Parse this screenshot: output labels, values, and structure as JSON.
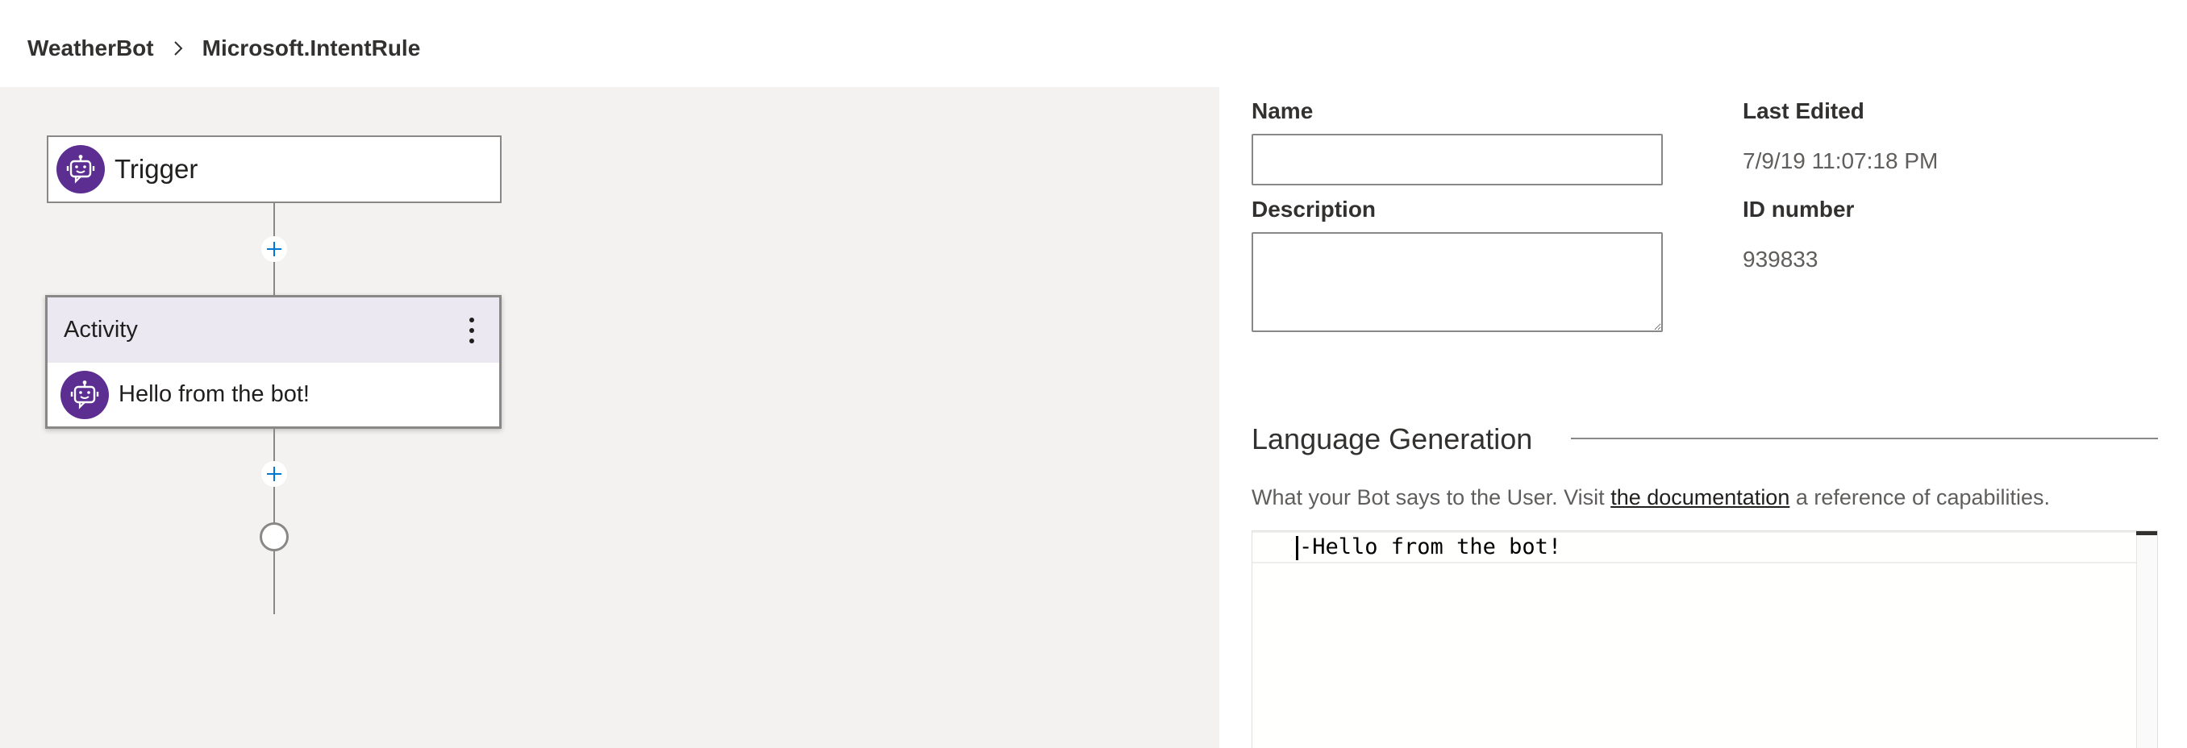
{
  "breadcrumb": {
    "items": [
      "WeatherBot"
    ],
    "current": "Microsoft.IntentRule",
    "separator_icon": "chevron-right-icon"
  },
  "canvas": {
    "trigger": {
      "label": "Trigger",
      "icon": "bot-icon"
    },
    "activity": {
      "title": "Activity",
      "menu_icon": "more-vertical-icon",
      "message": "Hello from the bot!",
      "icon": "bot-icon"
    },
    "add_step_icon": "plus-icon",
    "end_icon": "end-circle-icon"
  },
  "properties": {
    "name": {
      "label": "Name",
      "value": "",
      "placeholder": ""
    },
    "description": {
      "label": "Description",
      "value": "",
      "placeholder": ""
    },
    "last_edited": {
      "label": "Last Edited",
      "value": "7/9/19 11:07:18 PM"
    },
    "id_number": {
      "label": "ID number",
      "value": "939833"
    }
  },
  "language_generation": {
    "title": "Language Generation",
    "help_prefix": "What your Bot says to the User. Visit ",
    "help_link": "the documentation",
    "help_suffix": " a reference of capabilities.",
    "editor_text": "-Hello from the bot!"
  },
  "colors": {
    "accent_purple": "#5c2e91",
    "activity_header_bg": "#ece8f1",
    "canvas_bg": "#f3f2f1",
    "plus_blue": "#0078d4"
  }
}
